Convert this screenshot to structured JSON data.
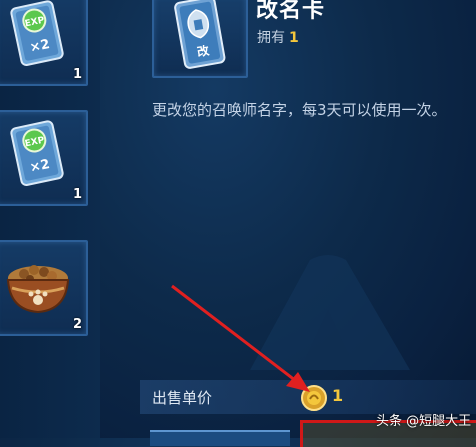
{
  "inventory": {
    "items": [
      {
        "icon": "exp-card-icon",
        "badge": "EXP",
        "mult": "×2",
        "qty": "1"
      },
      {
        "icon": "exp-card-icon",
        "badge": "EXP",
        "mult": "×2",
        "qty": "1"
      },
      {
        "icon": "food-bowl-icon",
        "qty": "2"
      }
    ]
  },
  "detail": {
    "title": "改名卡",
    "card_char": "改",
    "owned_label": "拥有",
    "owned_count": "1",
    "description": "更改您的召唤师名字，每3天可以使用一次。"
  },
  "price": {
    "label": "出售单价",
    "value": "1"
  },
  "watermark": "头条 @短腿大王",
  "colors": {
    "gold": "#f4c73c",
    "highlight_box": "#d01818",
    "arrow": "#e02020"
  }
}
